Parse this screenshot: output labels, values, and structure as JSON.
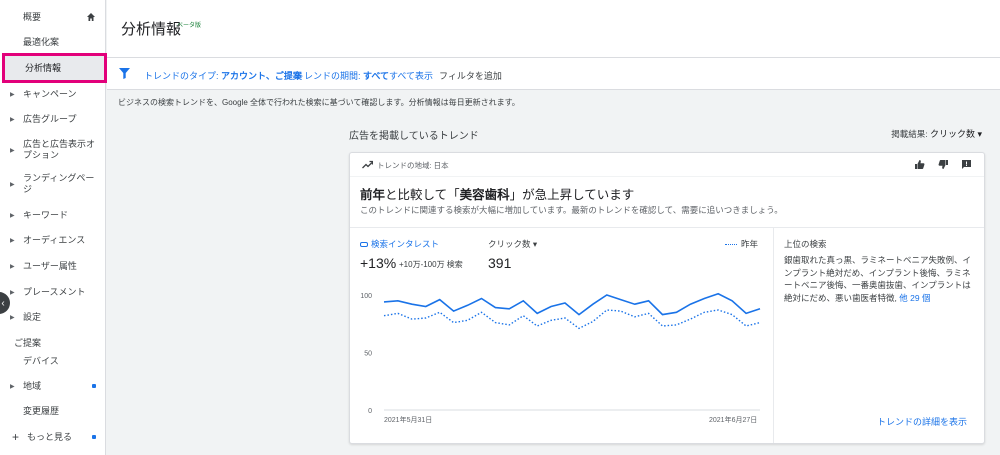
{
  "sidebar": {
    "overview": "概要",
    "recommendations": "最適化案",
    "insights": "分析情報",
    "items": [
      {
        "label": "キャンペーン"
      },
      {
        "label": "広告グループ"
      },
      {
        "label": "広告と広告表示オプション"
      },
      {
        "label": "ランディングページ"
      },
      {
        "label": "キーワード"
      },
      {
        "label": "オーディエンス"
      },
      {
        "label": "ユーザー属性"
      },
      {
        "label": "プレースメント"
      },
      {
        "label": "設定"
      }
    ],
    "section_suggestions": "ご提案",
    "devices": "デバイス",
    "location": "地域",
    "change_history": "変更履歴",
    "show_more": "もっと見る"
  },
  "header": {
    "title": "分析情報",
    "beta": "ベータ版"
  },
  "filterbar": {
    "type_prefix": "トレンドのタイプ: ",
    "type_value": "アカウント、ご提案",
    "period_prefix": "トレンドの期間: ",
    "period_value": "すべて",
    "show_all": "すべて表示",
    "add_filter": "フィルタを追加"
  },
  "info_text": "ビジネスの検索トレンドを、Google 全体で行われた検索に基づいて確認します。分析情報は毎日更新されます。",
  "section_title": "広告を掲載しているトレンド",
  "sort": {
    "label": "掲載結果:",
    "value": "クリック数 ▾"
  },
  "card": {
    "region": "トレンドの地域: 日本",
    "headline_prefix": "前年",
    "headline_mid": "と比較して「",
    "headline_term": "美容歯科",
    "headline_suffix": "」が急上昇しています",
    "subline": "このトレンドに関連する検索が大幅に増加しています。最新のトレンドを確認して、需要に追いつきましょう。",
    "legend_search": "検索インタレスト",
    "legend_clicks": "クリック数 ▾",
    "legend_prev": "昨年",
    "search_change": "+13%",
    "search_range": "+10万-100万 検索",
    "clicks_value": "391",
    "date_start": "2021年5月31日",
    "date_end": "2021年6月27日",
    "top_searches_title": "上位の検索",
    "top_searches_body": "銀歯取れた真っ黒、ラミネートベニア失敗例、インプラント絶対だめ、インプラント後悔、ラミネートベニア後悔、一番奥歯抜歯、インプラントは絶対にだめ、悪い歯医者特徴,",
    "top_searches_more": "他 29 個",
    "details_link": "トレンドの詳細を表示"
  },
  "chart_data": {
    "type": "line",
    "x": [
      "2021年5月31日",
      "2021年6月27日"
    ],
    "yticks": [
      "100",
      "50",
      "0"
    ],
    "ylim": [
      0,
      100
    ],
    "series": [
      {
        "name": "検索インタレスト",
        "style": "solid",
        "color": "#1a73e8",
        "values": [
          94,
          95,
          92,
          90,
          96,
          86,
          91,
          97,
          89,
          88,
          95,
          84,
          90,
          93,
          83,
          92,
          100,
          96,
          92,
          95,
          83,
          85,
          92,
          97,
          101,
          95,
          84,
          88
        ]
      },
      {
        "name": "昨年",
        "style": "dotted",
        "color": "#1a73e8",
        "values": [
          82,
          84,
          79,
          80,
          85,
          76,
          78,
          85,
          76,
          74,
          82,
          73,
          78,
          80,
          71,
          77,
          87,
          86,
          81,
          84,
          73,
          74,
          79,
          85,
          87,
          83,
          73,
          76
        ]
      }
    ]
  },
  "colors": {
    "accent": "#1a73e8",
    "highlight": "#e2007a",
    "beta": "#188038"
  }
}
